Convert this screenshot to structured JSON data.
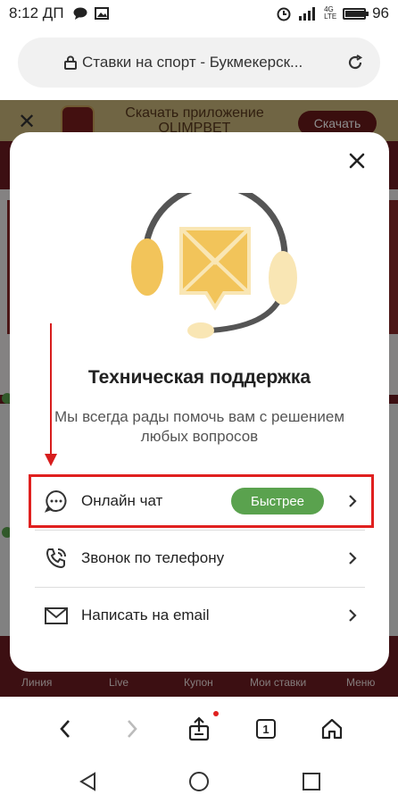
{
  "status_bar": {
    "time": "8:12 ДП",
    "network_label": "4G LTE",
    "battery": "96",
    "battery_level": 0.96
  },
  "browser": {
    "url_title": "Ставки на спорт - Букмекерск..."
  },
  "page": {
    "banner_text": "Скачать приложение OLIMPBET",
    "banner_button": "Скачать",
    "bottom_nav": [
      "Линия",
      "Live",
      "Купон",
      "Мои ставки",
      "Меню"
    ]
  },
  "modal": {
    "title": "Техническая поддержка",
    "subtitle": "Мы всегда рады помочь вам с решением любых вопросов",
    "options": [
      {
        "label": "Онлайн чат",
        "badge": "Быстрее",
        "icon": "chat-bubble-icon"
      },
      {
        "label": "Звонок по телефону",
        "icon": "phone-icon"
      },
      {
        "label": "Написать на email",
        "icon": "mail-icon"
      }
    ]
  },
  "browser_toolbar": {
    "tabs_count": "1"
  },
  "colors": {
    "accent_green": "#5aa24e",
    "highlight_red": "#e0201f",
    "page_brand": "#6d1d22",
    "illustration_yellow": "#f2c45a"
  }
}
